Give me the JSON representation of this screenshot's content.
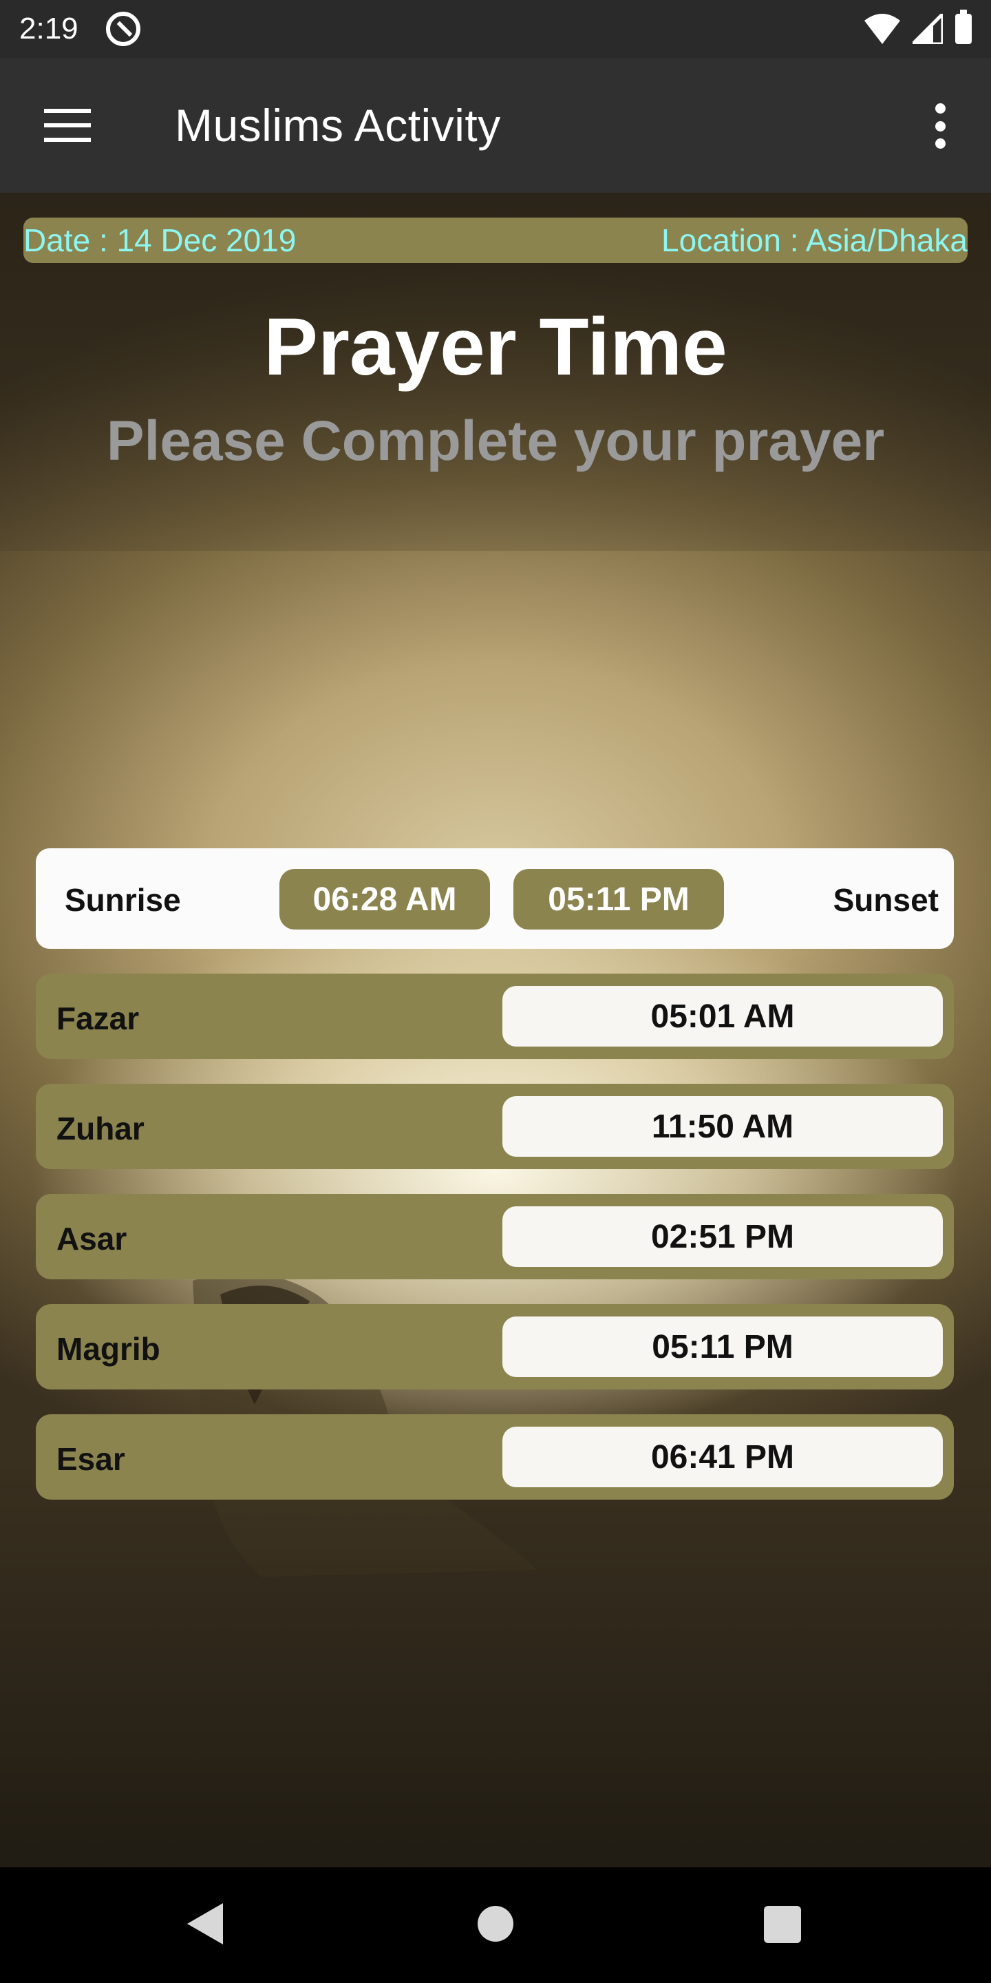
{
  "status_bar": {
    "time": "2:19"
  },
  "app_bar": {
    "title": "Muslims Activity"
  },
  "info": {
    "date": "Date : 14 Dec 2019",
    "location": "Location : Asia/Dhaka"
  },
  "header": {
    "title": "Prayer Time",
    "subtitle": "Please Complete your prayer"
  },
  "sun": {
    "sunrise_label": "Sunrise",
    "sunrise_time": "06:28 AM",
    "sunset_time": "05:11 PM",
    "sunset_label": "Sunset"
  },
  "prayers": [
    {
      "name": "Fazar",
      "time": "05:01 AM"
    },
    {
      "name": "Zuhar",
      "time": "11:50 AM"
    },
    {
      "name": "Asar",
      "time": "02:51 PM"
    },
    {
      "name": "Magrib",
      "time": "05:11 PM"
    },
    {
      "name": "Esar",
      "time": "06:41 PM"
    }
  ],
  "colors": {
    "accent": "#8c844f",
    "info_text": "#8ef6f0",
    "app_bar": "#303030"
  }
}
